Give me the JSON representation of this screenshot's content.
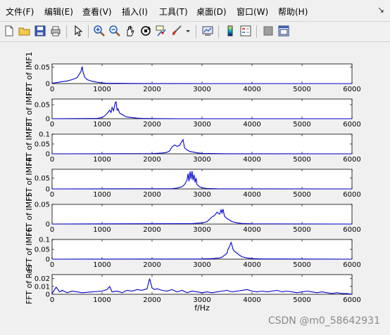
{
  "menu": {
    "items": [
      "文件(F)",
      "编辑(E)",
      "查看(V)",
      "插入(I)",
      "工具(T)",
      "桌面(D)",
      "窗口(W)",
      "帮助(H)"
    ],
    "corner": "↘"
  },
  "toolbar": {
    "icons": [
      "new-file-icon",
      "open-folder-icon",
      "save-icon",
      "print-icon",
      "pointer-icon",
      "zoom-in-icon",
      "zoom-out-icon",
      "pan-hand-icon",
      "rotate-3d-icon",
      "data-cursor-icon",
      "brush-icon",
      "link-plot-icon",
      "colorbar-icon",
      "legend-icon",
      "hide-plot-tools-icon",
      "show-plot-tools-icon"
    ]
  },
  "figure": {
    "xlabel": "f/Hz",
    "x_ticks": [
      "0",
      "1000",
      "2000",
      "3000",
      "4000",
      "5000",
      "6000"
    ],
    "line_color": "#0000cc"
  },
  "chart_data": [
    {
      "type": "line",
      "ylabel": "FFT of IMF1",
      "ylim": [
        0,
        0.06
      ],
      "yticks": [
        "0",
        "0.05"
      ],
      "xlim": [
        0,
        6000
      ],
      "x": [
        0,
        100,
        200,
        300,
        400,
        500,
        550,
        580,
        600,
        620,
        650,
        700,
        800,
        900,
        1000,
        1100,
        1300,
        1600,
        2000,
        3000,
        6000
      ],
      "y": [
        0.001,
        0.003,
        0.006,
        0.008,
        0.012,
        0.018,
        0.03,
        0.038,
        0.052,
        0.035,
        0.02,
        0.012,
        0.007,
        0.004,
        0.002,
        0.001,
        0.0008,
        0.0004,
        0.0002,
        0.0001,
        0
      ]
    },
    {
      "type": "line",
      "ylabel": "FFT of IMF2",
      "ylim": [
        0,
        0.07
      ],
      "yticks": [
        "0",
        "0.05"
      ],
      "xlim": [
        0,
        6000
      ],
      "x": [
        0,
        900,
        1000,
        1050,
        1100,
        1150,
        1180,
        1200,
        1230,
        1260,
        1280,
        1300,
        1320,
        1350,
        1400,
        1450,
        1500,
        1600,
        1700,
        1800,
        2000,
        2500,
        6000
      ],
      "y": [
        0,
        0.001,
        0.004,
        0.01,
        0.018,
        0.03,
        0.022,
        0.04,
        0.028,
        0.055,
        0.06,
        0.03,
        0.035,
        0.02,
        0.015,
        0.01,
        0.006,
        0.004,
        0.002,
        0.001,
        0.0004,
        0.0001,
        0
      ]
    },
    {
      "type": "line",
      "ylabel": "FFT of IMF3",
      "ylim": [
        0,
        0.1
      ],
      "yticks": [
        "0",
        "0.05",
        "0.1"
      ],
      "xlim": [
        0,
        6000
      ],
      "x": [
        0,
        2000,
        2200,
        2300,
        2350,
        2400,
        2450,
        2500,
        2550,
        2600,
        2620,
        2650,
        2700,
        2750,
        2800,
        2900,
        3000,
        3500,
        6000
      ],
      "y": [
        0,
        0.001,
        0.004,
        0.008,
        0.015,
        0.035,
        0.045,
        0.038,
        0.042,
        0.065,
        0.072,
        0.03,
        0.02,
        0.012,
        0.01,
        0.005,
        0.002,
        0.0005,
        0
      ]
    },
    {
      "type": "line",
      "ylabel": "FFT of IMF4",
      "ylim": [
        0,
        0.09
      ],
      "yticks": [
        "0",
        "0.05"
      ],
      "xlim": [
        0,
        6000
      ],
      "x": [
        0,
        2400,
        2500,
        2600,
        2650,
        2700,
        2720,
        2740,
        2760,
        2780,
        2800,
        2820,
        2840,
        2860,
        2880,
        2900,
        2950,
        3000,
        3100,
        3300,
        6000
      ],
      "y": [
        0,
        0.001,
        0.004,
        0.01,
        0.02,
        0.04,
        0.07,
        0.035,
        0.08,
        0.045,
        0.082,
        0.04,
        0.065,
        0.03,
        0.05,
        0.02,
        0.01,
        0.005,
        0.002,
        0.0005,
        0
      ]
    },
    {
      "type": "line",
      "ylabel": "FFT of IMF5",
      "ylim": [
        0,
        0.05
      ],
      "yticks": [
        "0",
        "0.05"
      ],
      "xlim": [
        0,
        6000
      ],
      "x": [
        0,
        2800,
        3000,
        3100,
        3150,
        3200,
        3250,
        3300,
        3350,
        3380,
        3400,
        3420,
        3450,
        3500,
        3550,
        3600,
        3700,
        3800,
        4000,
        6000
      ],
      "y": [
        0,
        0.001,
        0.003,
        0.006,
        0.012,
        0.018,
        0.022,
        0.03,
        0.025,
        0.036,
        0.028,
        0.038,
        0.02,
        0.014,
        0.01,
        0.006,
        0.003,
        0.0015,
        0.0005,
        0
      ]
    },
    {
      "type": "line",
      "ylabel": "FFT of IMF6",
      "ylim": [
        0,
        0.1
      ],
      "yticks": [
        "0",
        "0.05",
        "0.1"
      ],
      "xlim": [
        0,
        6000
      ],
      "x": [
        0,
        3000,
        3200,
        3350,
        3400,
        3450,
        3500,
        3520,
        3550,
        3580,
        3600,
        3620,
        3650,
        3700,
        3750,
        3800,
        3900,
        4000,
        4200,
        6000
      ],
      "y": [
        0,
        0.001,
        0.003,
        0.006,
        0.01,
        0.02,
        0.03,
        0.05,
        0.065,
        0.085,
        0.07,
        0.05,
        0.04,
        0.03,
        0.02,
        0.012,
        0.006,
        0.003,
        0.001,
        0
      ]
    },
    {
      "type": "line",
      "ylabel": "FFT of Res",
      "ylim": [
        0,
        0.025
      ],
      "yticks": [
        "0",
        "0.01",
        "0.02"
      ],
      "xlim": [
        0,
        6000
      ],
      "x": [
        0,
        80,
        150,
        200,
        300,
        400,
        500,
        600,
        800,
        1000,
        1100,
        1150,
        1200,
        1300,
        1400,
        1500,
        1600,
        1700,
        1800,
        1900,
        1950,
        2000,
        2050,
        2100,
        2200,
        2300,
        2400,
        2500,
        2600,
        2700,
        2800,
        2900,
        3000,
        3100,
        3200,
        3300,
        3400,
        3500,
        3600,
        3700,
        3800,
        3900,
        4000,
        4100,
        4200,
        4300,
        4400,
        4500,
        4600,
        4700,
        4800,
        4900,
        5000,
        5100,
        5200,
        5300,
        5400,
        5500,
        5600,
        5700,
        5800,
        5900,
        6000
      ],
      "y": [
        0.001,
        0.009,
        0.003,
        0.005,
        0.002,
        0.004,
        0.003,
        0.002,
        0.003,
        0.004,
        0.006,
        0.01,
        0.003,
        0.004,
        0.002,
        0.005,
        0.004,
        0.006,
        0.005,
        0.007,
        0.02,
        0.008,
        0.006,
        0.007,
        0.005,
        0.004,
        0.006,
        0.003,
        0.005,
        0.002,
        0.004,
        0.003,
        0.002,
        0.003,
        0.002,
        0.003,
        0.004,
        0.005,
        0.003,
        0.004,
        0.005,
        0.006,
        0.004,
        0.003,
        0.004,
        0.003,
        0.004,
        0.005,
        0.003,
        0.004,
        0.003,
        0.002,
        0.003,
        0.004,
        0.003,
        0.002,
        0.003,
        0.002,
        0.001,
        0.002,
        0.001,
        0.001,
        0
      ]
    }
  ],
  "watermark": "CSDN @m0_58642931"
}
